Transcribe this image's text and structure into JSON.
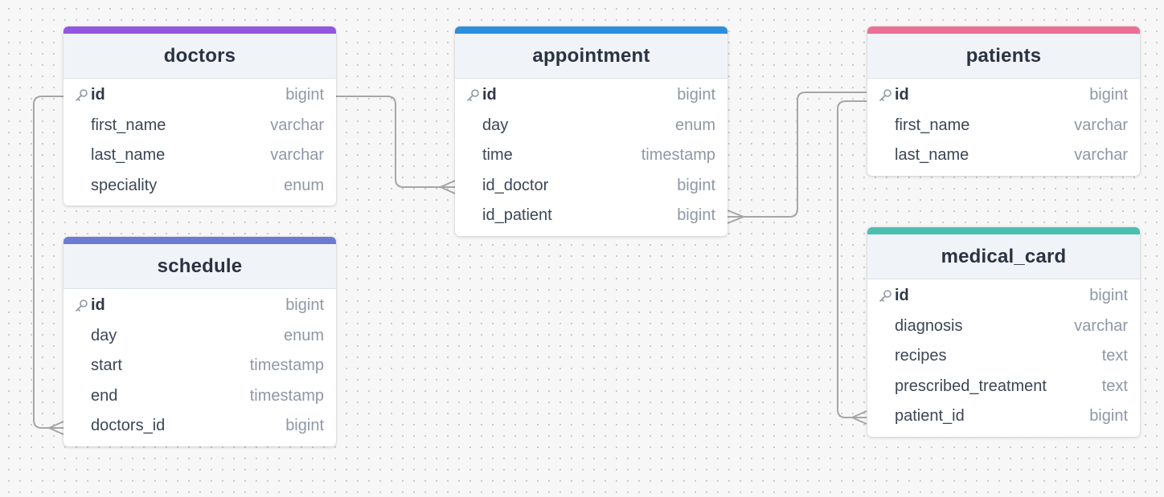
{
  "tables": {
    "doctors": {
      "name": "doctors",
      "color": "#9256e0",
      "columns": [
        {
          "name": "id",
          "type": "bigint",
          "pk": true
        },
        {
          "name": "first_name",
          "type": "varchar"
        },
        {
          "name": "last_name",
          "type": "varchar"
        },
        {
          "name": "speciality",
          "type": "enum"
        }
      ]
    },
    "schedule": {
      "name": "schedule",
      "color": "#6b7bd4",
      "columns": [
        {
          "name": "id",
          "type": "bigint",
          "pk": true
        },
        {
          "name": "day",
          "type": "enum"
        },
        {
          "name": "start",
          "type": "timestamp"
        },
        {
          "name": "end",
          "type": "timestamp"
        },
        {
          "name": "doctors_id",
          "type": "bigint"
        }
      ]
    },
    "appointment": {
      "name": "appointment",
      "color": "#2c8fdc",
      "columns": [
        {
          "name": "id",
          "type": "bigint",
          "pk": true
        },
        {
          "name": "day",
          "type": "enum"
        },
        {
          "name": "time",
          "type": "timestamp"
        },
        {
          "name": "id_doctor",
          "type": "bigint"
        },
        {
          "name": "id_patient",
          "type": "bigint"
        }
      ]
    },
    "patients": {
      "name": "patients",
      "color": "#ec6f96",
      "columns": [
        {
          "name": "id",
          "type": "bigint",
          "pk": true
        },
        {
          "name": "first_name",
          "type": "varchar"
        },
        {
          "name": "last_name",
          "type": "varchar"
        }
      ]
    },
    "medical_card": {
      "name": "medical_card",
      "color": "#4dbfb0",
      "columns": [
        {
          "name": "id",
          "type": "bigint",
          "pk": true
        },
        {
          "name": "diagnosis",
          "type": "varchar"
        },
        {
          "name": "recipes",
          "type": "text"
        },
        {
          "name": "prescribed_treatment",
          "type": "text"
        },
        {
          "name": "patient_id",
          "type": "bigint"
        }
      ]
    }
  },
  "relationships": [
    {
      "from": "doctors.id",
      "to": "schedule.doctors_id",
      "cardinality": "one-to-many"
    },
    {
      "from": "doctors.id",
      "to": "appointment.id_doctor",
      "cardinality": "one-to-many"
    },
    {
      "from": "patients.id",
      "to": "appointment.id_patient",
      "cardinality": "one-to-many"
    },
    {
      "from": "patients.id",
      "to": "medical_card.patient_id",
      "cardinality": "one-to-many"
    }
  ],
  "colors": {
    "connector": "#a6a6a6",
    "key_icon": "#8f98a6"
  },
  "icons": {
    "primary_key": "key-icon"
  }
}
